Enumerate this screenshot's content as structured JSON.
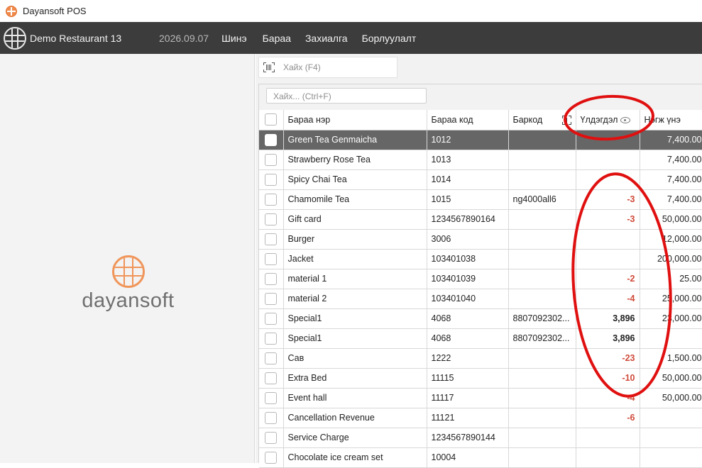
{
  "window": {
    "title": "Dayansoft POS",
    "icon": "app-logo-icon"
  },
  "navbar": {
    "restaurant": "Demo Restaurant 13",
    "date": "2026.09.07",
    "items": [
      {
        "label": "Шинэ"
      },
      {
        "label": "Бараа"
      },
      {
        "label": "Захиалга"
      },
      {
        "label": "Борлуулалт"
      }
    ]
  },
  "brand": {
    "name": "dayansoft",
    "logo_color": "#f0955a"
  },
  "search": {
    "placeholder": "Хайх (F4)",
    "icon": "barcode-scan-icon"
  },
  "filter": {
    "placeholder": "Хайх... (Ctrl+F)"
  },
  "table": {
    "columns": {
      "name": "Бараа нэр",
      "code": "Бараа код",
      "barcode": "Баркод",
      "stock": "Үлдэгдэл",
      "price": "Нэгж үнэ"
    },
    "rows": [
      {
        "name": "Green Tea Genmaicha",
        "code": "1012",
        "barcode": "",
        "stock": "",
        "price": "7,400.00",
        "selected": true
      },
      {
        "name": "Strawberry Rose Tea",
        "code": "1013",
        "barcode": "",
        "stock": "",
        "price": "7,400.00"
      },
      {
        "name": "Spicy Chai Tea",
        "code": "1014",
        "barcode": "",
        "stock": "",
        "price": "7,400.00"
      },
      {
        "name": "Chamomile Tea",
        "code": "1015",
        "barcode": "ng4000all6",
        "stock": "-3",
        "price": "7,400.00"
      },
      {
        "name": "Gift card",
        "code": "1234567890164",
        "barcode": "",
        "stock": "-3",
        "price": "50,000.00"
      },
      {
        "name": "Burger",
        "code": "3006",
        "barcode": "",
        "stock": "",
        "price": "12,000.00"
      },
      {
        "name": "Jacket",
        "code": "103401038",
        "barcode": "",
        "stock": "",
        "price": "200,000.00"
      },
      {
        "name": "material 1",
        "code": "103401039",
        "barcode": "",
        "stock": "-2",
        "price": "25.00"
      },
      {
        "name": "material 2",
        "code": "103401040",
        "barcode": "",
        "stock": "-4",
        "price": "25,000.00"
      },
      {
        "name": "Special1",
        "code": "4068",
        "barcode": "8807092302...",
        "stock": "3,896",
        "price": "23,000.00"
      },
      {
        "name": "Special1",
        "code": "4068",
        "barcode": "8807092302...",
        "stock": "3,896",
        "price": ""
      },
      {
        "name": "Сав",
        "code": "1222",
        "barcode": "",
        "stock": "-23",
        "price": "1,500.00"
      },
      {
        "name": "Extra Bed",
        "code": "11115",
        "barcode": "",
        "stock": "-10",
        "price": "50,000.00"
      },
      {
        "name": "Event hall",
        "code": "11117",
        "barcode": "",
        "stock": "-4",
        "price": "50,000.00"
      },
      {
        "name": "Cancellation Revenue",
        "code": "11121",
        "barcode": "",
        "stock": "-6",
        "price": ""
      },
      {
        "name": "Service Charge",
        "code": "1234567890144",
        "barcode": "",
        "stock": "",
        "price": ""
      },
      {
        "name": "Chocolate ice cream set",
        "code": "10004",
        "barcode": "",
        "stock": "",
        "price": ""
      }
    ]
  },
  "annotation_color": "#e01010"
}
